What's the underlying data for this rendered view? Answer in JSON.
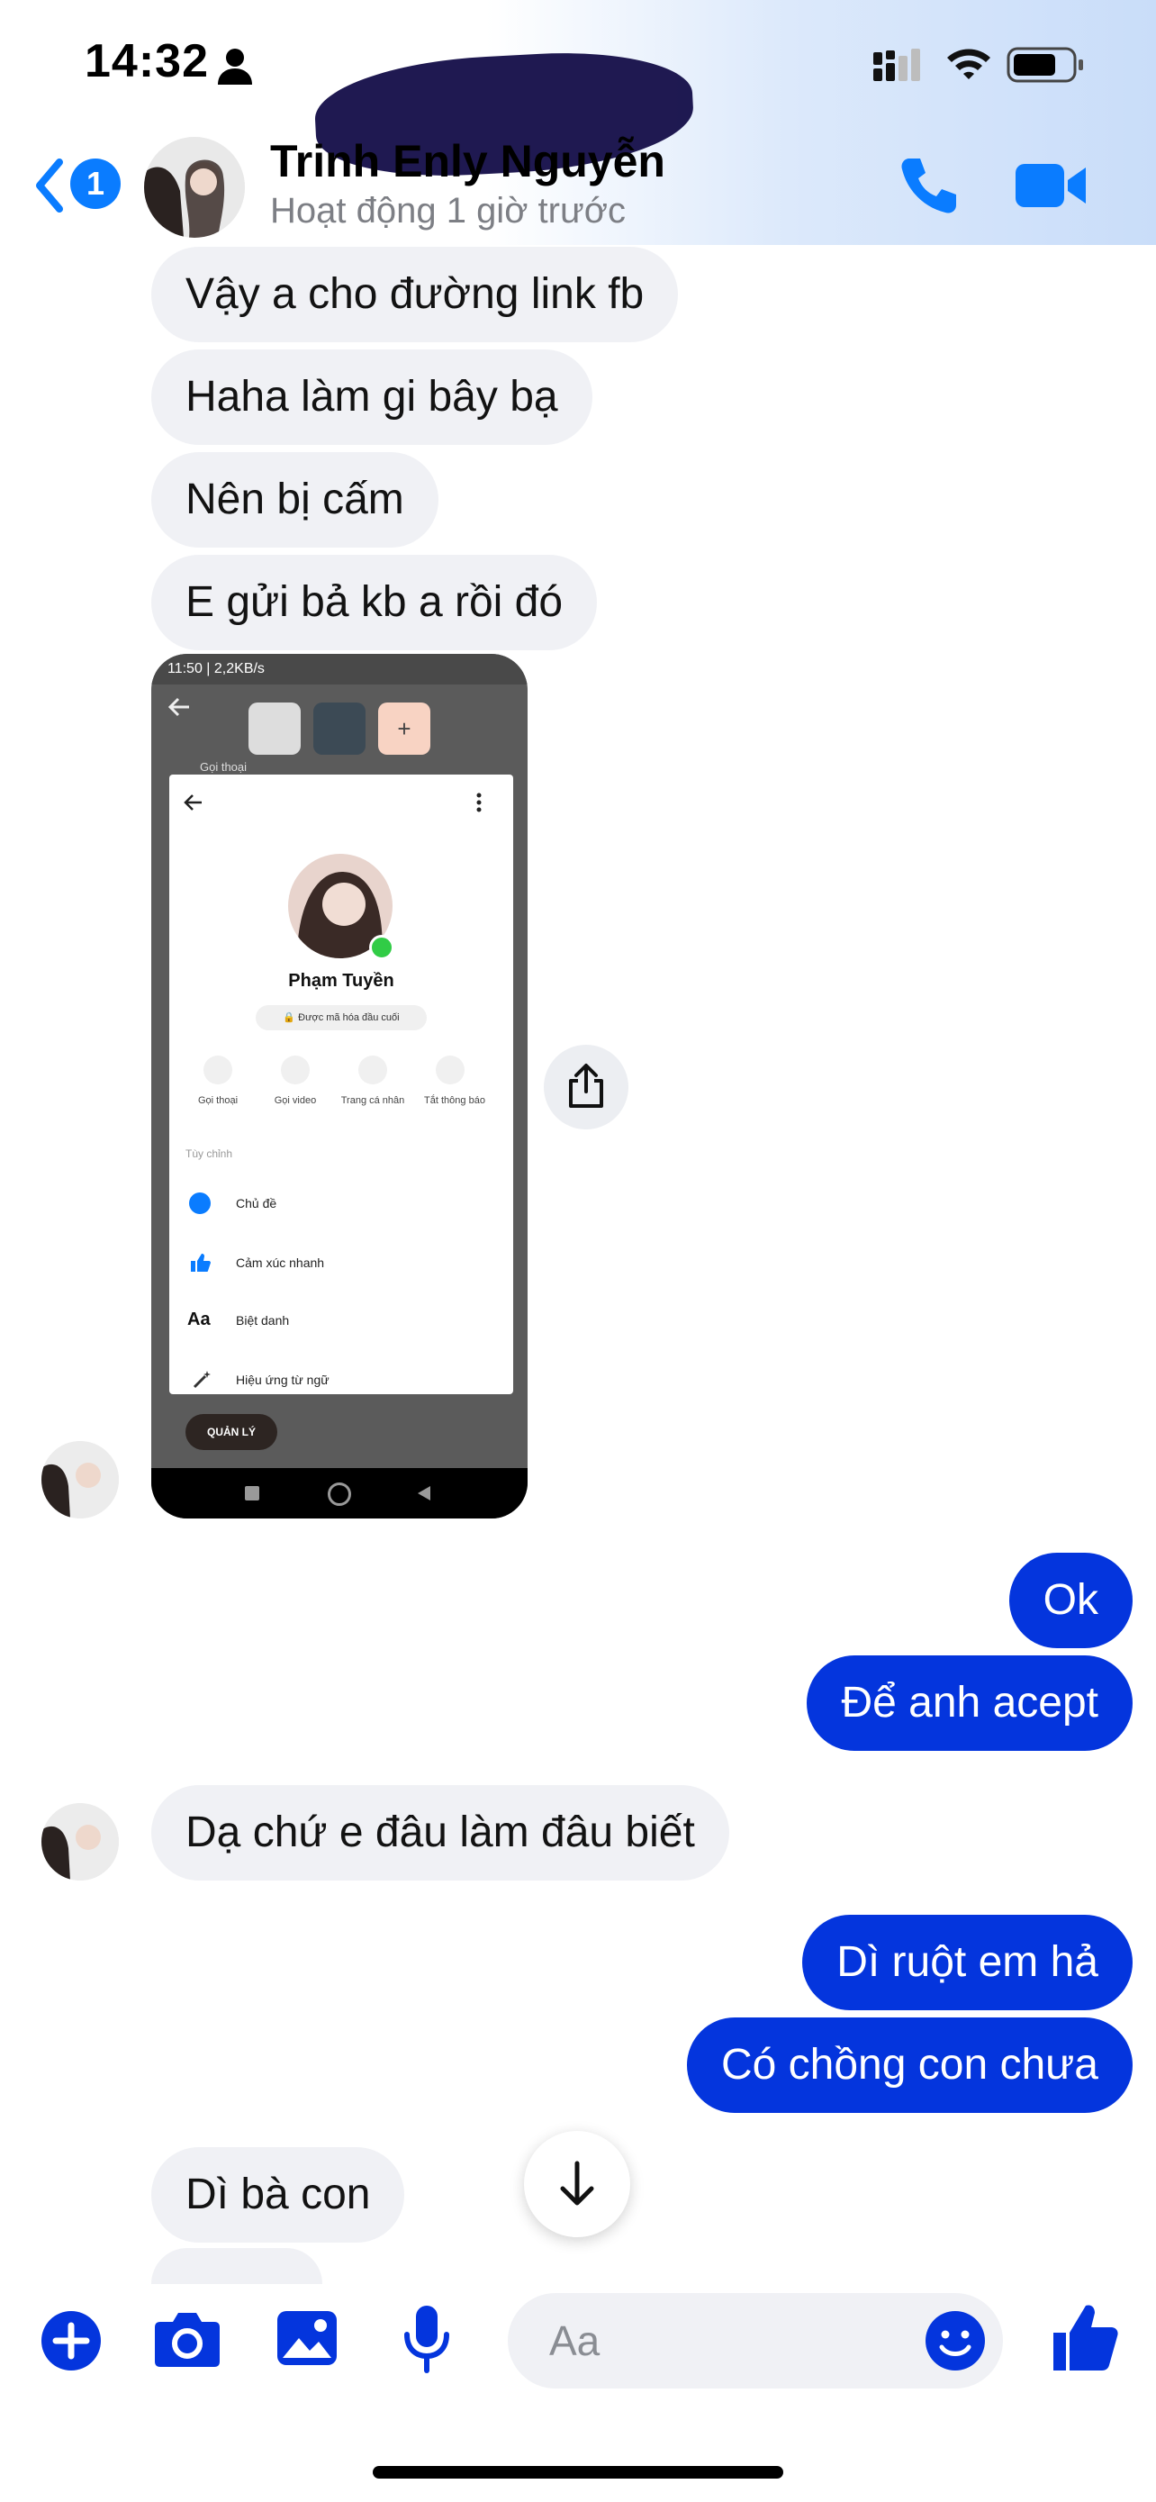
{
  "status_bar": {
    "time": "14:32"
  },
  "header": {
    "back_badge": "1",
    "contact_name": "Trinh Enly Nguyễn",
    "contact_status": "Hoạt động 1 giờ trước"
  },
  "messages": [
    {
      "side": "in",
      "text": "Vậy a cho đường link fb"
    },
    {
      "side": "in",
      "text": "Haha làm gi bây bạ"
    },
    {
      "side": "in",
      "text": "Nên bị cấm"
    },
    {
      "side": "in",
      "text": "E gửi bả kb a rồi đó"
    },
    {
      "side": "out",
      "text": "Ok"
    },
    {
      "side": "out",
      "text": "Để anh acept"
    },
    {
      "side": "in",
      "text": "Dạ chứ e đâu làm đâu biết"
    },
    {
      "side": "out",
      "text": "Dì ruột em hả"
    },
    {
      "side": "out",
      "text": "Có chồng con chưa"
    },
    {
      "side": "in",
      "text": "Dì bà con"
    }
  ],
  "attachment": {
    "status_text": "11:50 | 2,2KB/s",
    "profile_name": "Phạm Tuyền",
    "encryption_label": "Được mã hóa đầu cuối",
    "actions": [
      "Gọi thoại",
      "Gọi video",
      "Trang cá nhân",
      "Tắt thông báo"
    ],
    "section_label": "Tùy chỉnh",
    "options": [
      "Chủ đề",
      "Cảm xúc nhanh",
      "Biệt danh",
      "Hiệu ứng từ ngữ"
    ],
    "aa_glyph": "Aa",
    "behind_label": "Gọi thoại",
    "manage_button": "QUẢN LÝ"
  },
  "composer": {
    "placeholder": "Aa"
  },
  "colors": {
    "accent": "#0a7cff",
    "outgoing": "#0435dd",
    "incoming": "#f0f1f5"
  }
}
